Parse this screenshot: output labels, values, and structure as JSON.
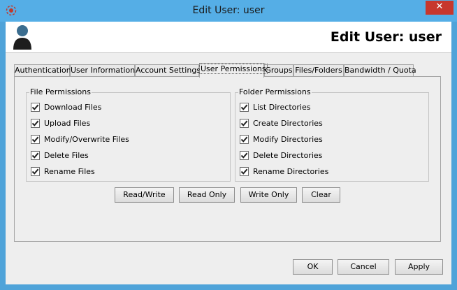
{
  "window": {
    "title": "Edit User: user",
    "close_glyph": "✕"
  },
  "header": {
    "title": "Edit User: user",
    "icon": "user-silhouette-icon"
  },
  "tabs": [
    {
      "label": "Authentication",
      "active": false
    },
    {
      "label": "User Information",
      "active": false
    },
    {
      "label": "Account Settings",
      "active": false
    },
    {
      "label": "User Permissions",
      "active": true
    },
    {
      "label": "Groups",
      "active": false
    },
    {
      "label": "Files/Folders",
      "active": false
    },
    {
      "label": "Bandwidth / Quota",
      "active": false
    }
  ],
  "file_permissions": {
    "legend": "File Permissions",
    "items": [
      {
        "label": "Download Files",
        "checked": true
      },
      {
        "label": "Upload Files",
        "checked": true
      },
      {
        "label": "Modify/Overwrite Files",
        "checked": true
      },
      {
        "label": "Delete Files",
        "checked": true
      },
      {
        "label": "Rename Files",
        "checked": true
      }
    ]
  },
  "folder_permissions": {
    "legend": "Folder Permissions",
    "items": [
      {
        "label": "List Directories",
        "checked": true
      },
      {
        "label": "Create Directories",
        "checked": true
      },
      {
        "label": "Modify Directories",
        "checked": true
      },
      {
        "label": "Delete Directories",
        "checked": true
      },
      {
        "label": "Rename Directories",
        "checked": true
      }
    ]
  },
  "preset_buttons": {
    "read_write": "Read/Write",
    "read_only": "Read Only",
    "write_only": "Write Only",
    "clear": "Clear"
  },
  "footer_buttons": {
    "ok": "OK",
    "cancel": "Cancel",
    "apply": "Apply"
  },
  "colors": {
    "titlebar": "#55aee6",
    "close_button": "#c7372d",
    "client_background": "#eeeeee"
  }
}
